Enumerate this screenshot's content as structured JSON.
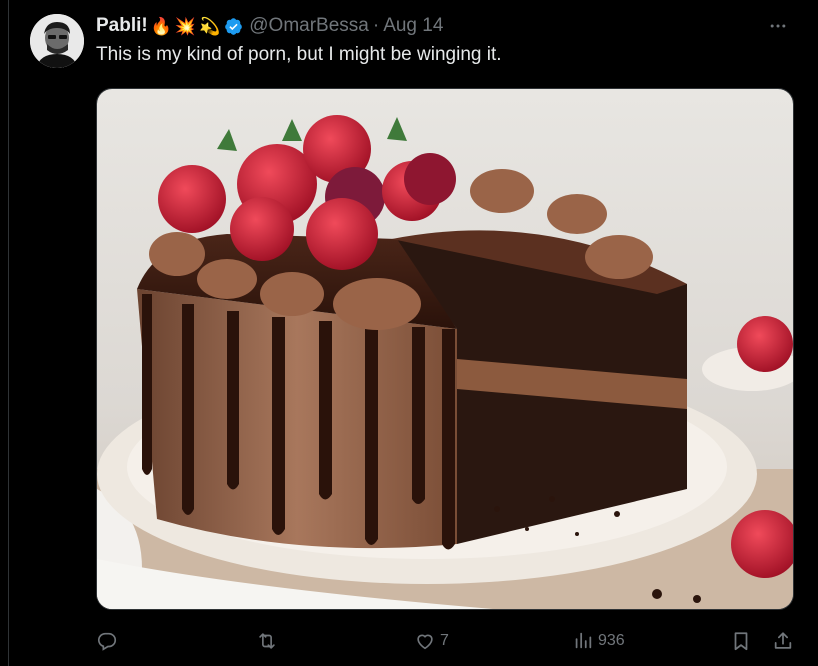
{
  "author": {
    "display_name": "Pabli!",
    "emojis": [
      "🔥",
      "💥",
      "💫"
    ],
    "verified": true,
    "handle": "@OmarBessa",
    "separator": "·",
    "time": "Aug 14"
  },
  "text": "This is my kind of porn, but I might be winging it.",
  "media": {
    "kind": "photo",
    "subject": "chocolate-cake"
  },
  "actions": {
    "reply_count": "",
    "retweet_count": "",
    "like_count": "7",
    "views_count": "936"
  },
  "colors": {
    "background": "#000000",
    "text": "#e7e9ea",
    "muted": "#71767b",
    "verified": "#1d9bf0",
    "border": "#2f3336"
  },
  "icons": {
    "more": "more-icon",
    "reply": "reply-icon",
    "retweet": "retweet-icon",
    "like": "heart-icon",
    "views": "views-icon",
    "bookmark": "bookmark-icon",
    "share": "share-icon",
    "verified": "verified-badge-icon"
  }
}
